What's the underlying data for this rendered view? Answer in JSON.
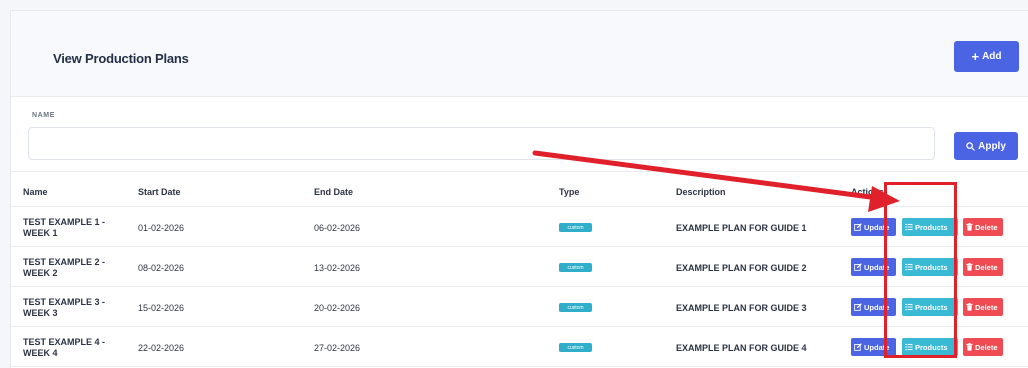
{
  "header": {
    "title": "View Production Plans",
    "add_label": "Add"
  },
  "filter": {
    "label": "NAME",
    "value": "",
    "apply_label": "Apply"
  },
  "table": {
    "columns": [
      "Name",
      "Start Date",
      "End Date",
      "Type",
      "Description",
      "Actions"
    ],
    "rows": [
      {
        "name": "TEST EXAMPLE 1 - WEEK 1",
        "start": "01-02-2026",
        "end": "06-02-2026",
        "type": "custom",
        "description": "EXAMPLE PLAN FOR GUIDE 1"
      },
      {
        "name": "TEST EXAMPLE 2 - WEEK 2",
        "start": "08-02-2026",
        "end": "13-02-2026",
        "type": "custom",
        "description": "EXAMPLE PLAN FOR GUIDE 2"
      },
      {
        "name": "TEST EXAMPLE 3 - WEEK 3",
        "start": "15-02-2026",
        "end": "20-02-2026",
        "type": "custom",
        "description": "EXAMPLE PLAN FOR GUIDE 3"
      },
      {
        "name": "TEST EXAMPLE 4 - WEEK 4",
        "start": "22-02-2026",
        "end": "27-02-2026",
        "type": "custom",
        "description": "EXAMPLE PLAN FOR GUIDE 4"
      }
    ],
    "actions": {
      "update_label": "Update",
      "products_label": "Products",
      "delete_label": "Delete"
    }
  },
  "colors": {
    "primary": "#4a64e4",
    "info": "#39b9d4",
    "danger": "#ef4b52",
    "annotation": "#e0202b"
  }
}
